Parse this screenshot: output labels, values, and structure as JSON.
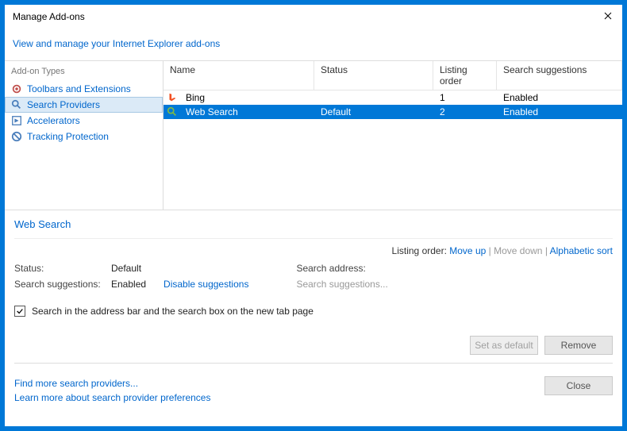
{
  "window": {
    "title": "Manage Add-ons"
  },
  "subtitle": "View and manage your Internet Explorer add-ons",
  "sidebar": {
    "heading": "Add-on Types",
    "items": [
      {
        "label": "Toolbars and Extensions"
      },
      {
        "label": "Search Providers"
      },
      {
        "label": "Accelerators"
      },
      {
        "label": "Tracking Protection"
      }
    ]
  },
  "list": {
    "headers": {
      "name": "Name",
      "status": "Status",
      "order": "Listing order",
      "sugg": "Search suggestions"
    },
    "rows": [
      {
        "name": "Bing",
        "status": "",
        "order": "1",
        "sugg": "Enabled"
      },
      {
        "name": "Web Search",
        "status": "Default",
        "order": "2",
        "sugg": "Enabled"
      }
    ]
  },
  "details": {
    "title": "Web Search",
    "listing_order_label": "Listing order:",
    "move_up": "Move up",
    "move_down": "Move down",
    "alpha_sort": "Alphabetic sort",
    "status_label": "Status:",
    "status_value": "Default",
    "sugg_label": "Search suggestions:",
    "sugg_value": "Enabled",
    "disable_link": "Disable suggestions",
    "search_address_label": "Search address:",
    "search_sugg_placeholder": "Search suggestions...",
    "checkbox_label": "Search in the address bar and the search box on the new tab page"
  },
  "buttons": {
    "set_default": "Set as default",
    "remove": "Remove",
    "close": "Close"
  },
  "footer": {
    "find_more": "Find more search providers...",
    "learn_more": "Learn more about search provider preferences"
  }
}
